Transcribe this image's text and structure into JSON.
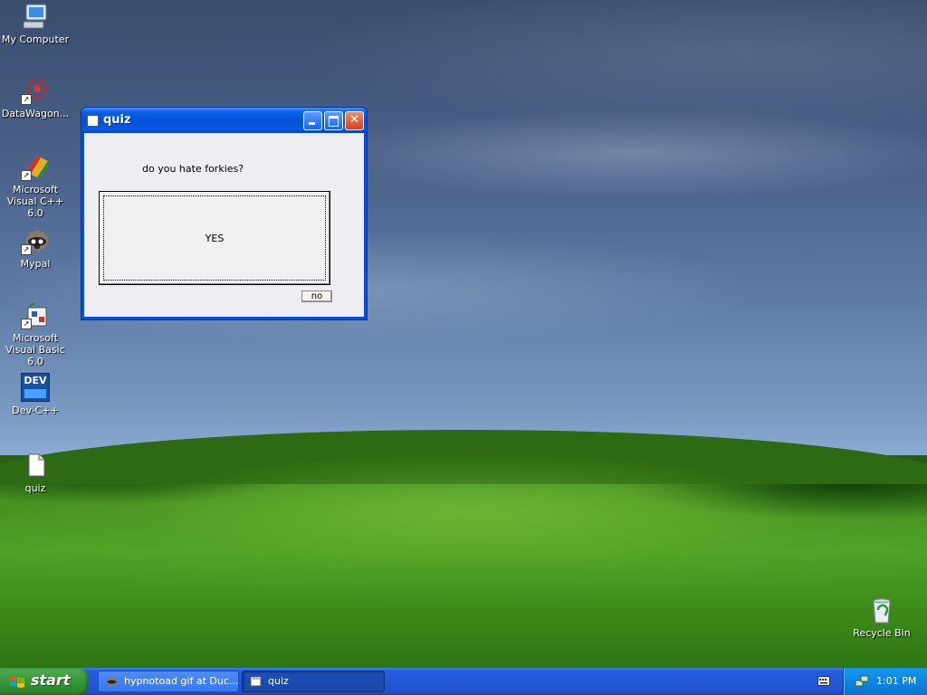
{
  "desktop": {
    "icons": [
      {
        "label": "My Computer",
        "icon": "my-computer-icon"
      },
      {
        "label": "DataWagon...",
        "icon": "datawagon-icon"
      },
      {
        "label": "Microsoft Visual C++ 6.0",
        "icon": "visual-cpp-icon"
      },
      {
        "label": "Mypal",
        "icon": "mypal-icon"
      },
      {
        "label": "Microsoft Visual Basic 6.0",
        "icon": "visual-basic-icon"
      },
      {
        "label": "Dev-C++",
        "icon": "dev-cpp-icon"
      },
      {
        "label": "quiz",
        "icon": "file-icon"
      },
      {
        "label": "Recycle Bin",
        "icon": "recycle-bin-icon"
      }
    ],
    "devcpp_badge": "DEV"
  },
  "window": {
    "title": "quiz",
    "question": "do you hate forkies?",
    "yes_label": "YES",
    "no_label": "no"
  },
  "taskbar": {
    "start_label": "start",
    "tasks": [
      {
        "label": "hypnotoad gif at Duc...",
        "active": false
      },
      {
        "label": "quiz",
        "active": true
      }
    ],
    "clock": "1:01 PM"
  }
}
